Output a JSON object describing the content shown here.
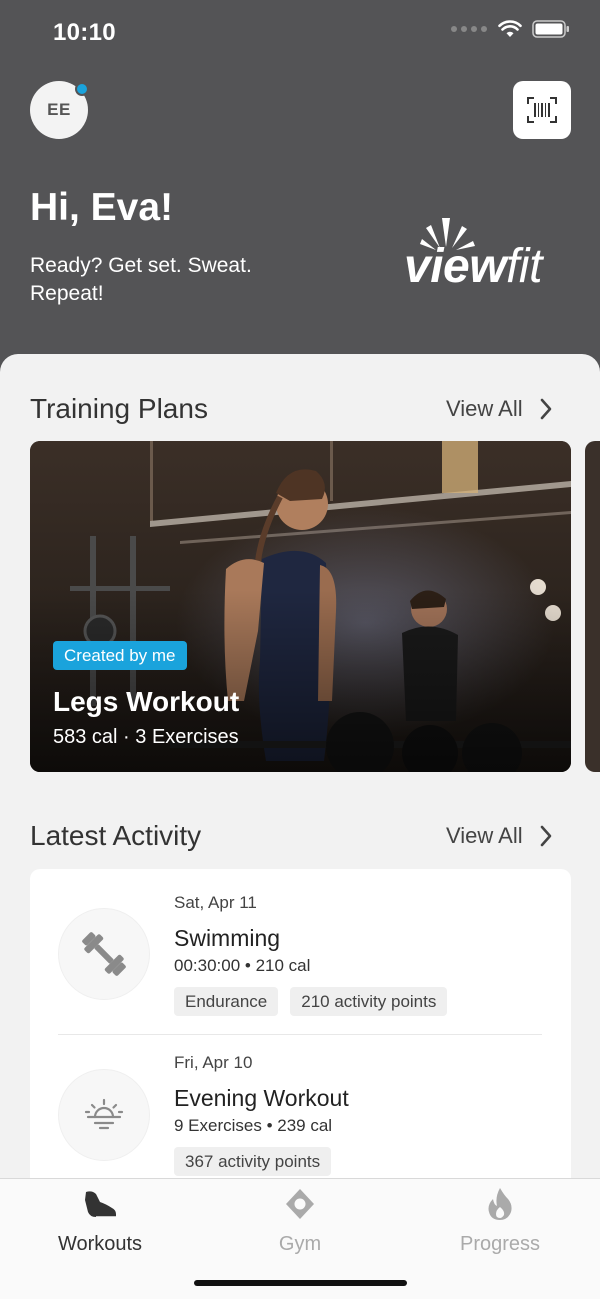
{
  "status_bar": {
    "time": "10:10"
  },
  "header": {
    "avatar_initials": "EE",
    "greeting": "Hi, Eva!",
    "tagline": "Ready? Get set. Sweat. Repeat!",
    "logo": {
      "part1": "view",
      "part2": "fit"
    }
  },
  "training_plans": {
    "title": "Training Plans",
    "view_all": "View All",
    "plans": [
      {
        "badge": "Created by me",
        "title": "Legs Workout",
        "meta": "583 cal · 3 Exercises"
      }
    ]
  },
  "latest_activity": {
    "title": "Latest Activity",
    "view_all": "View All",
    "items": [
      {
        "date": "Sat, Apr 11",
        "title": "Swimming",
        "meta": "00:30:00 • 210 cal",
        "icon": "dumbbell-icon",
        "chips": [
          "Endurance",
          "210 activity points"
        ]
      },
      {
        "date": "Fri, Apr 10",
        "title": "Evening Workout",
        "meta": "9 Exercises • 239 cal",
        "icon": "sunset-icon",
        "chips": [
          "367 activity points"
        ]
      }
    ]
  },
  "tab_bar": {
    "tabs": [
      {
        "label": "Workouts",
        "icon": "shoe-icon",
        "active": true
      },
      {
        "label": "Gym",
        "icon": "location-icon",
        "active": false
      },
      {
        "label": "Progress",
        "icon": "flame-icon",
        "active": false
      }
    ]
  },
  "colors": {
    "header_bg": "#545456",
    "accent": "#1aa3dc",
    "inactive_tab": "#aaaaaa",
    "active_tab": "#333333"
  }
}
